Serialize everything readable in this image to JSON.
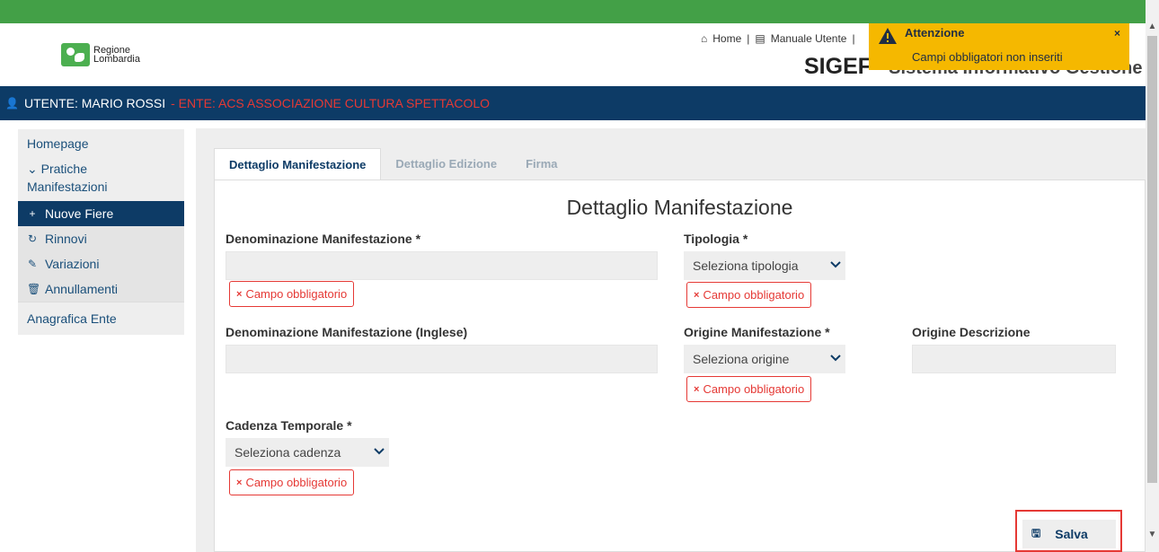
{
  "header": {
    "logo_line1": "Regione",
    "logo_line2": "Lombardia",
    "home_link": "Home",
    "manual_link": "Manuale Utente",
    "sep": "|",
    "app_title": "SIGEF",
    "app_subtitle": "- Sistema Informativo Gestione Fiere"
  },
  "userbar": {
    "user": "UTENTE: MARIO ROSSI",
    "ente": "- ENTE: ACS ASSOCIAZIONE CULTURA SPETTACOLO"
  },
  "sidebar": {
    "homepage": "Homepage",
    "group_line1": "Pratiche",
    "group_line2": "Manifestazioni",
    "items": [
      {
        "label": "Nuove Fiere",
        "icon": "+"
      },
      {
        "label": "Rinnovi",
        "icon": "↻"
      },
      {
        "label": "Variazioni",
        "icon": "✎"
      },
      {
        "label": "Annullamenti",
        "icon": "🗑"
      }
    ],
    "anagrafica": "Anagrafica Ente"
  },
  "tabs": [
    "Dettaglio Manifestazione",
    "Dettaglio Edizione",
    "Firma"
  ],
  "form": {
    "title": "Dettaglio Manifestazione",
    "denominazione_label": "Denominazione Manifestazione *",
    "denominazione_en_label": "Denominazione Manifestazione (Inglese)",
    "tipologia_label": "Tipologia *",
    "tipologia_value": "Seleziona tipologia",
    "origine_label": "Origine Manifestazione *",
    "origine_value": "Seleziona origine",
    "origine_desc_label": "Origine Descrizione",
    "cadenza_label": "Cadenza Temporale *",
    "cadenza_value": "Seleziona cadenza",
    "error_text": "Campo obbligatorio",
    "error_icon": "×"
  },
  "save": {
    "label": "Salva",
    "icon": "floppy-icon"
  },
  "toast": {
    "title": "Attenzione",
    "message": "Campi obbligatori non inseriti",
    "close": "×"
  },
  "colors": {
    "topbar": "#43a047",
    "navy": "#0d3b66",
    "error": "#e53935",
    "toast": "#f5b800"
  }
}
